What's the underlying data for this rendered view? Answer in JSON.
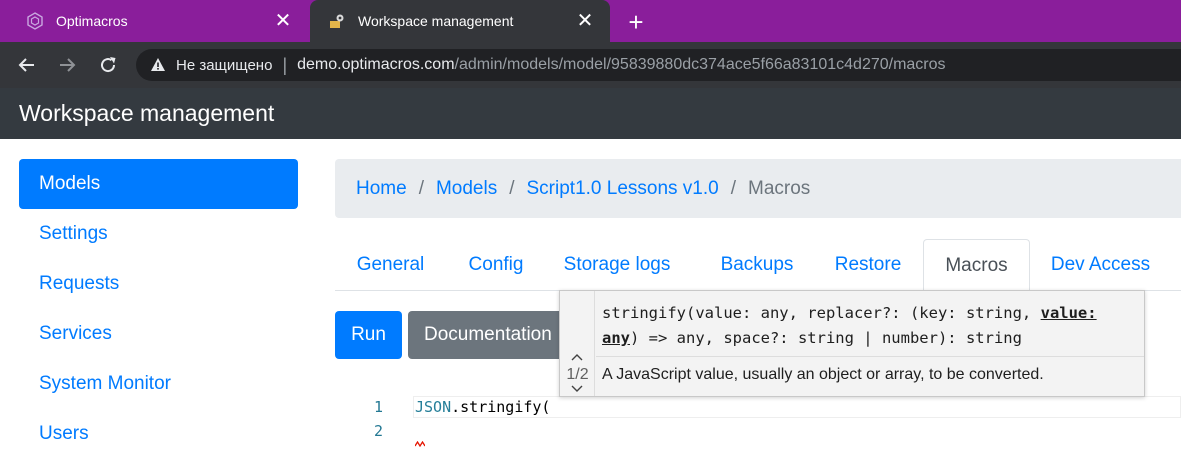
{
  "browser": {
    "tabs": [
      {
        "title": "Optimacros",
        "icon": "optimacros-logo-icon",
        "active": false
      },
      {
        "title": "Workspace management",
        "icon": "admin-favicon-icon",
        "active": true
      }
    ],
    "close_symbol": "✕",
    "new_tab_symbol": "+",
    "address": {
      "security_label": "Не защищено",
      "url_host": "demo.optimacros.com",
      "url_path": "/admin/models/model/95839880dc374ace5f66a83101c4d270/macros"
    },
    "colors": {
      "tab_strip": "#8a1e9b",
      "toolbar": "#34363a",
      "omnibox": "#202124"
    }
  },
  "app": {
    "title": "Workspace management"
  },
  "sidebar": {
    "items": [
      {
        "label": "Models",
        "active": true
      },
      {
        "label": "Settings",
        "active": false
      },
      {
        "label": "Requests",
        "active": false
      },
      {
        "label": "Services",
        "active": false
      },
      {
        "label": "System Monitor",
        "active": false
      },
      {
        "label": "Users",
        "active": false
      }
    ]
  },
  "breadcrumb": {
    "items": [
      "Home",
      "Models",
      "Script1.0 Lessons v1.0",
      "Macros"
    ],
    "separator": "/"
  },
  "tabs": {
    "items": [
      "General",
      "Config",
      "Storage logs",
      "Backups",
      "Restore",
      "Macros",
      "Dev Access"
    ],
    "active": "Macros"
  },
  "buttons": {
    "run": "Run",
    "documentation": "Documentation"
  },
  "editor": {
    "line_numbers": [
      "1",
      "2"
    ],
    "line1_ident": "JSON",
    "line1_rest": ".stringify("
  },
  "parameter_hints": {
    "counter": "1/2",
    "signature_before": "stringify(value: any, replacer?: (key: string, ",
    "signature_param": "value: any",
    "signature_after": ") => any, space?: string | number): string",
    "documentation": "A JavaScript value, usually an object or array, to be converted."
  },
  "colors": {
    "primary": "#007bff",
    "secondary": "#6c757d",
    "appbar": "#343a40"
  }
}
